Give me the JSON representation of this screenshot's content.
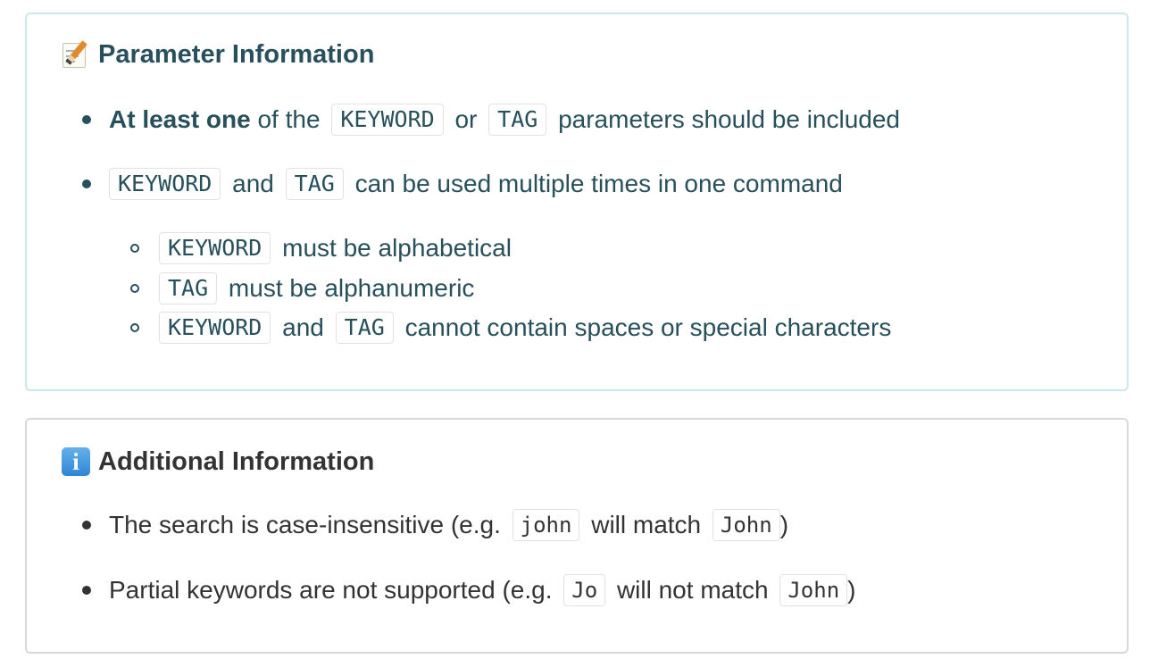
{
  "param_box": {
    "emoji_name": "memo-icon",
    "title": "Parameter Information",
    "bullets": [
      {
        "strong": "At least one",
        "text_1": " of the ",
        "code_1": "KEYWORD",
        "text_2": " or ",
        "code_2": "TAG",
        "text_3": " parameters should be included"
      },
      {
        "code_1": "KEYWORD",
        "text_1": " and ",
        "code_2": "TAG",
        "text_2": " can be used multiple times in one command"
      }
    ],
    "sub_bullets": [
      {
        "code_1": "KEYWORD",
        "text_1": " must be alphabetical"
      },
      {
        "code_1": "TAG",
        "text_1": " must be alphanumeric"
      },
      {
        "code_1": "KEYWORD",
        "text_1": " and ",
        "code_2": "TAG",
        "text_2": " cannot contain spaces or special characters"
      }
    ],
    "border_color": "#cde6ec",
    "text_color": "#27505c"
  },
  "info_box": {
    "emoji_name": "information-icon",
    "emoji_glyph": "i",
    "title": "Additional Information",
    "bullets": [
      {
        "text_1": "The search is case-insensitive (e.g. ",
        "code_1": "john",
        "text_2": " will match ",
        "code_2": "John",
        "text_3": ")"
      },
      {
        "text_1": "Partial keywords are not supported (e.g. ",
        "code_1": "Jo",
        "text_2": " will not match ",
        "code_2": "John",
        "text_3": ")"
      }
    ],
    "border_color": "#d8d8d8",
    "text_color": "#333333"
  }
}
